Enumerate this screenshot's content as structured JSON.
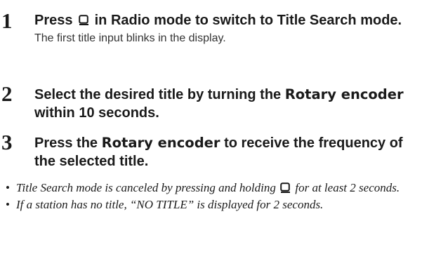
{
  "steps": [
    {
      "number": "1",
      "line_before_icon": "Press",
      "icon": "title-search-icon",
      "line_after_icon": "in Radio mode to switch to Title Search mode.",
      "description": "The first title input blinks in the display."
    },
    {
      "number": "2",
      "text_before": "Select the desired title by turning the",
      "emphasis": "Rotary encoder",
      "text_after": "within 10 seconds."
    },
    {
      "number": "3",
      "text_before": "Press the",
      "emphasis": "Rotary encoder",
      "text_after": "to receive the frequency of the selected title."
    }
  ],
  "notes": [
    {
      "bullet": "•",
      "text_before_icon": "Title Search mode is canceled by pressing and holding",
      "icon": "title-search-icon",
      "text_after_icon": "for at least 2 seconds."
    },
    {
      "bullet": "•",
      "text": "If a station has no title, “NO TITLE” is displayed for 2 seconds."
    }
  ]
}
